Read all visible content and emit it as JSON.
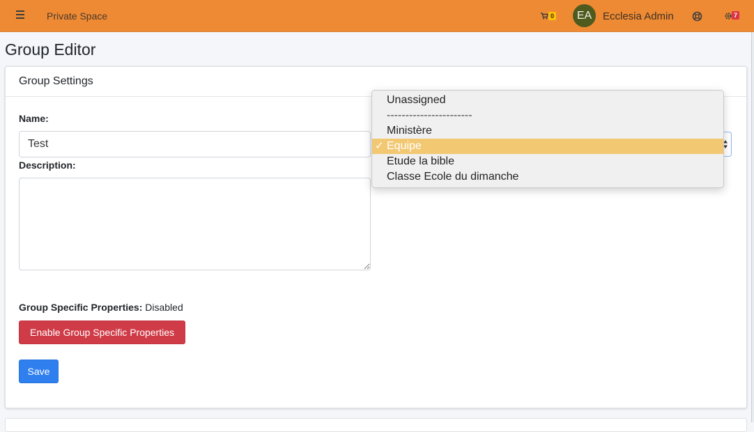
{
  "navbar": {
    "brand": "Private Space",
    "cart_count": "0",
    "avatar_initials": "EA",
    "user_name": "Ecclesia Admin",
    "tasks_count": "7",
    "colors": {
      "background": "#ee8a34",
      "cart_badge": "#ffc107",
      "tasks_badge": "#dc3545"
    }
  },
  "page": {
    "title": "Group Editor"
  },
  "card": {
    "header": "Group Settings",
    "name_label": "Name:",
    "name_value": "Test",
    "description_label": "Description:",
    "description_value": "",
    "props_label": "Group Specific Properties:",
    "props_status": "Disabled",
    "enable_button": "Enable Group Specific Properties",
    "save_button": "Save"
  },
  "group_type_select": {
    "selected": "Equipe",
    "options": [
      "Unassigned",
      "-----------------------",
      "Ministère",
      "Equipe",
      "Etude la bible",
      "Classe Ecole du dimanche"
    ],
    "selected_mark": "✓",
    "highlight_color": "#f2c872"
  },
  "icons": {
    "menu": "hamburger-icon",
    "cart": "shopping-cart-icon",
    "help": "lifebuoy-icon",
    "tasks": "gears-icon",
    "check": "checkmark-icon",
    "select_arrows": "up-down-arrows-icon"
  }
}
